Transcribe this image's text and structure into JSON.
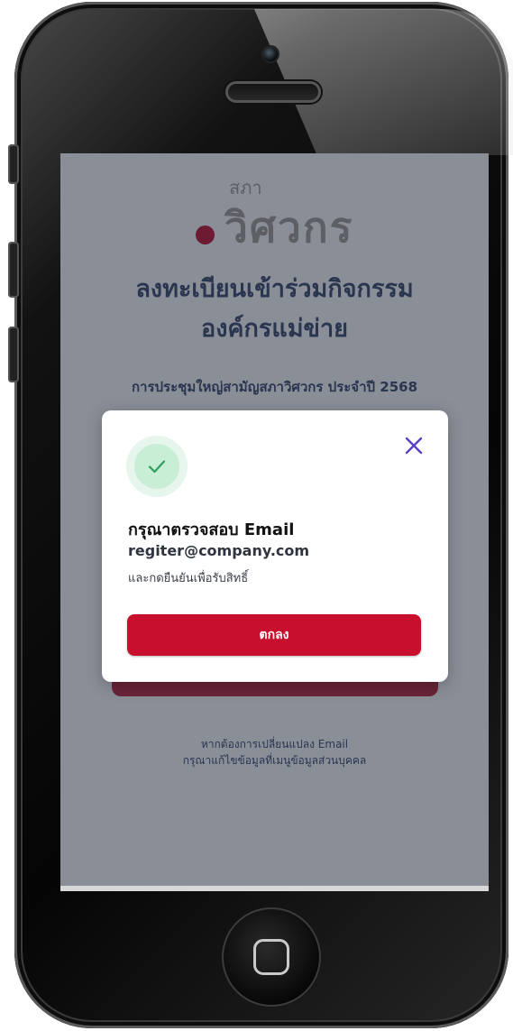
{
  "logo": {
    "small_text": "สภา",
    "main_text": "วิศวกร"
  },
  "page": {
    "title_line1": "ลงทะเบียนเข้าร่วมกิจกรรม",
    "title_line2": "องค์กรแม่ข่าย",
    "event_name": "การประชุมใหญ่สามัญสภาวิศวกร ประจำปี 2568"
  },
  "note": {
    "line1": "หากต้องการเปลี่ยนแปลง Email",
    "line2": "กรุณาแก้ไขข้อมูลที่เมนูข้อมูลส่วนบุคคล"
  },
  "modal": {
    "title": "กรุณาตรวจสอบ Email",
    "email": "regiter@company.com",
    "description": "และกดยืนยันเพื่อรับสิทธิ์",
    "ok_label": "ตกลง",
    "icons": {
      "status": "check-icon",
      "close": "close-icon"
    }
  },
  "colors": {
    "accent": "#c8102e",
    "success": "#2e9e5b",
    "close": "#5b3fc9",
    "overlay": "#8a8e97",
    "title": "#2a3550"
  }
}
